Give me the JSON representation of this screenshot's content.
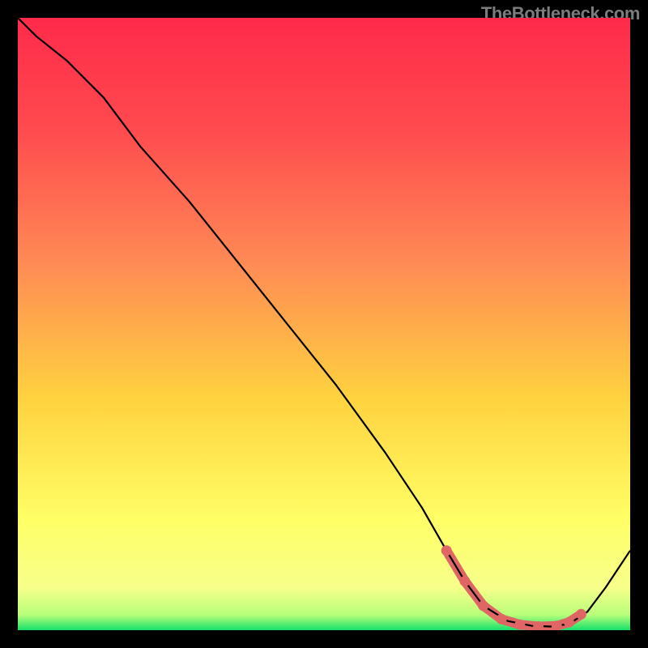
{
  "attribution": "TheBottleneck.com",
  "colors": {
    "top": "#ff2a4a",
    "mid1": "#ff7a55",
    "mid2": "#ffd23f",
    "low": "#ffff66",
    "base": "#15e06b",
    "curve": "#000000",
    "marker": "#e06666"
  },
  "chart_data": {
    "type": "line",
    "title": "",
    "xlabel": "",
    "ylabel": "",
    "xlim": [
      0,
      100
    ],
    "ylim": [
      0,
      100
    ],
    "series": [
      {
        "name": "bottleneck-curve",
        "x": [
          0,
          3,
          8,
          14,
          20,
          28,
          36,
          44,
          52,
          60,
          66,
          70,
          73,
          76,
          80,
          84,
          87,
          90,
          93,
          96,
          100
        ],
        "y": [
          100,
          97,
          93,
          87,
          79,
          70,
          60,
          50,
          40,
          29,
          20,
          13,
          8,
          4,
          1.5,
          0.7,
          0.6,
          1.0,
          3,
          7,
          13
        ]
      }
    ],
    "markers": {
      "name": "trough-markers",
      "x": [
        70,
        73,
        76,
        79,
        82,
        85,
        88,
        90,
        92
      ],
      "y": [
        13,
        8,
        4,
        1.8,
        0.9,
        0.6,
        0.7,
        1.3,
        2.6
      ]
    },
    "gradient_stops": [
      {
        "pos": 0.0,
        "color": "#ff2a4a"
      },
      {
        "pos": 0.18,
        "color": "#ff4a4e"
      },
      {
        "pos": 0.4,
        "color": "#ff8a55"
      },
      {
        "pos": 0.62,
        "color": "#ffd23f"
      },
      {
        "pos": 0.82,
        "color": "#ffff66"
      },
      {
        "pos": 0.93,
        "color": "#f7ff8a"
      },
      {
        "pos": 0.975,
        "color": "#b8ff7a"
      },
      {
        "pos": 1.0,
        "color": "#15e06b"
      }
    ]
  }
}
